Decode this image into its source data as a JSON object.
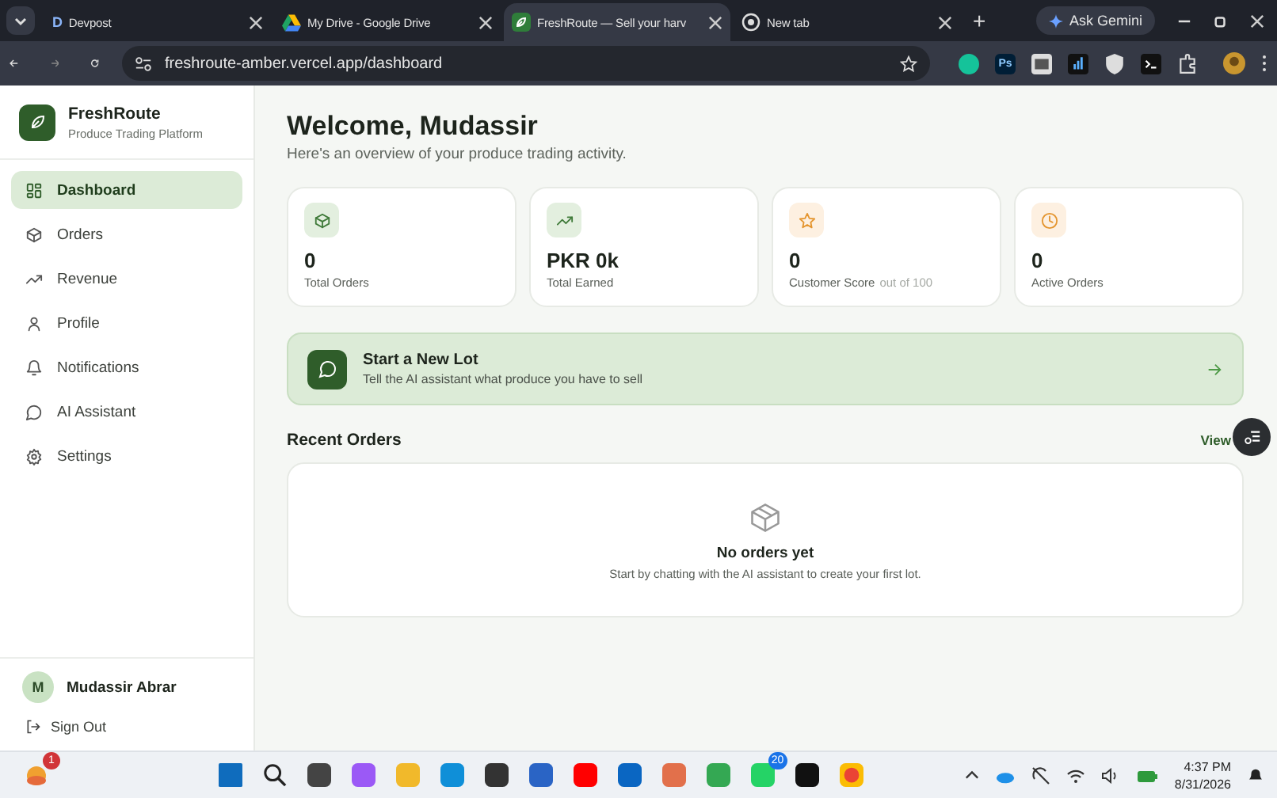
{
  "browser": {
    "tabs": [
      {
        "kind": "letter",
        "icon_text": "D",
        "title": "Devpost",
        "selected": false
      },
      {
        "kind": "drive",
        "title": "My Drive - Google Drive",
        "selected": false
      },
      {
        "kind": "leaf",
        "title": "FreshRoute — Sell your harv",
        "selected": true
      },
      {
        "kind": "globe",
        "title": "New tab",
        "selected": false
      }
    ],
    "new_tab": "+",
    "gemini": "Ask Gemini",
    "url": "freshroute-amber.vercel.app/dashboard",
    "extension_label": "Ps"
  },
  "sidebar": {
    "brand": "FreshRoute",
    "tagline": "Produce Trading Platform",
    "items": [
      {
        "label": "Dashboard",
        "selected": true
      },
      {
        "label": "Orders",
        "selected": false
      },
      {
        "label": "Revenue",
        "selected": false
      },
      {
        "label": "Profile",
        "selected": false
      },
      {
        "label": "Notifications",
        "selected": false
      },
      {
        "label": "AI Assistant",
        "selected": false
      },
      {
        "label": "Settings",
        "selected": false
      }
    ],
    "user": {
      "initial": "M",
      "name": "Mudassir Abrar"
    },
    "sign_out": "Sign Out"
  },
  "main": {
    "title": "Welcome, Mudassir",
    "subtitle": "Here's an overview of your produce trading activity.",
    "stats": [
      {
        "value": "0",
        "label": "Total Orders"
      },
      {
        "value": "PKR 0k",
        "label": "Total Earned"
      },
      {
        "value": "0",
        "label": "Customer Score",
        "note": "out of 100"
      },
      {
        "value": "0",
        "label": "Active Orders"
      }
    ],
    "banner": {
      "title": "Start a New Lot",
      "text": "Tell the AI assistant what produce you have to sell"
    },
    "recent": {
      "title": "Recent Orders",
      "link": "View",
      "empty_title": "No orders yet",
      "empty_text": "Start by chatting with the AI assistant to create your first lot."
    }
  },
  "taskbar": {
    "weather_badge": "1",
    "whatsapp_badge": "20",
    "time": "4:37 PM",
    "date": "8/31/2026"
  }
}
